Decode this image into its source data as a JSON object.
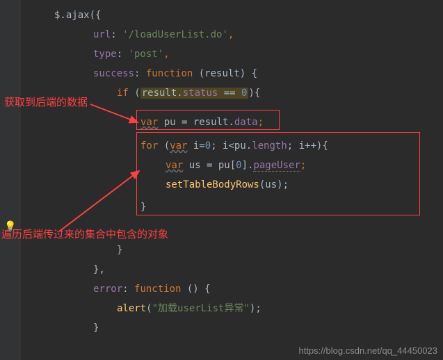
{
  "code": {
    "l1": "$.ajax({",
    "l2a": "url",
    "l2b": ": ",
    "l2c": "'/loadUserList.do'",
    "l2d": ",",
    "l3a": "type",
    "l3b": ": ",
    "l3c": "'post'",
    "l3d": ",",
    "l4a": "success",
    "l4b": ": ",
    "l4c": "function",
    "l4d": " (result) {",
    "l5a": "if",
    "l5b": " (",
    "l5c": "result",
    "l5d": ".",
    "l5e": "status",
    "l5f": " == ",
    "l5g": "0",
    "l5h": "){",
    "l6a": "var",
    "l6b": " pu = result.",
    "l6c": "data",
    "l6d": ";",
    "l7a": "for",
    "l7b": " (",
    "l7c": "var",
    "l7d": " i=",
    "l7e": "0",
    "l7f": "; i<pu.",
    "l7g": "length",
    "l7h": "; i++){",
    "l8a": "var",
    "l8b": " us = pu[",
    "l8c": "0",
    "l8d": "].",
    "l8e": "pageUser",
    "l8f": ";",
    "l9a": "setTableBodyRows",
    "l9b": "(us);",
    "l10": "}",
    "l12": "}",
    "l13": "},",
    "l14a": "error",
    "l14b": ": ",
    "l14c": "function",
    "l14d": " () {",
    "l15a": "alert",
    "l15b": "(",
    "l15c": "\"加载userList异常\"",
    "l15d": ");",
    "l16": "}"
  },
  "annotations": {
    "top": "获取到后端的数据",
    "bottom": "遍历后端传过来的集合中包含的对象"
  },
  "icons": {
    "bulb": "💡"
  },
  "watermark": "https://blog.csdn.net/qq_44450023"
}
